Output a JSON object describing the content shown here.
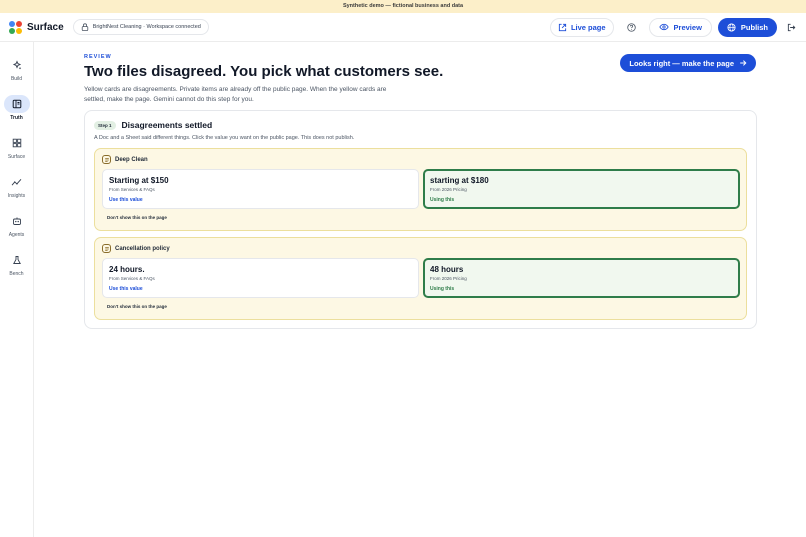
{
  "banner": {
    "text": "Synthetic demo — fictional business and data"
  },
  "header": {
    "brand": "Surface",
    "workspace": "BrightNest Cleaning · Workspace connected",
    "live_page": "Live page",
    "preview": "Preview",
    "publish": "Publish"
  },
  "sidebar": {
    "items": [
      {
        "label": "Build",
        "icon": "build-icon"
      },
      {
        "label": "Truth",
        "icon": "truth-icon"
      },
      {
        "label": "Surface",
        "icon": "surface-icon"
      },
      {
        "label": "Insights",
        "icon": "insights-icon"
      },
      {
        "label": "Agents",
        "icon": "agents-icon"
      },
      {
        "label": "Bench",
        "icon": "bench-icon"
      }
    ]
  },
  "main": {
    "eyebrow": "REVIEW",
    "title": "Two files disagreed. You pick what customers see.",
    "description": "Yellow cards are disagreements. Private items are already off the public page. When the yellow cards are settled, make the page. Gemini cannot do this step for you.",
    "approve_button": "Looks right — make the page"
  },
  "step": {
    "badge": "Step 1",
    "title": "Disagreements settled",
    "note": "A Doc and a Sheet said different things. Click the value you want on the public page. This does not publish."
  },
  "groups": [
    {
      "title": "Deep Clean",
      "left": {
        "value": "Starting at $150",
        "source": "From Services & FAQs",
        "action": "Use this value"
      },
      "right": {
        "value": "starting at $180",
        "source": "From 2026 Pricing",
        "action": "Using this"
      },
      "dont_show": "Don't show this on the page"
    },
    {
      "title": "Cancellation policy",
      "left": {
        "value": "24 hours.",
        "source": "From Services & FAQs",
        "action": "Use this value"
      },
      "right": {
        "value": "48 hours",
        "source": "From 2026 Pricing",
        "action": "Using this"
      },
      "dont_show": "Don't show this on the page"
    }
  ],
  "colors": {
    "accent": "#1d4ed8",
    "selected": "#2f7d4a",
    "conflict_bg": "#fdf8e4",
    "banner_bg": "#fcefc9"
  }
}
